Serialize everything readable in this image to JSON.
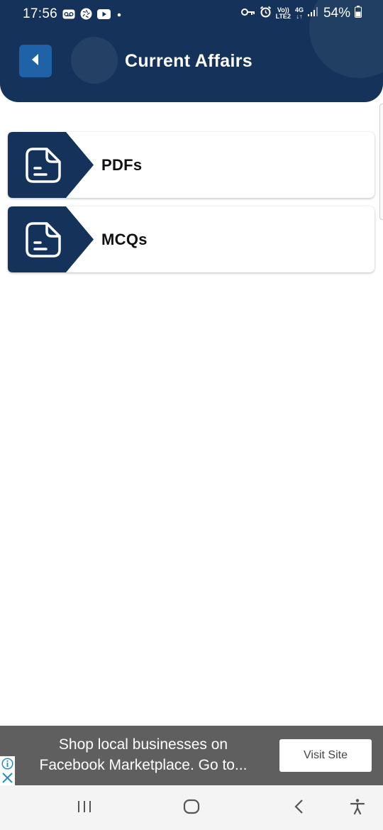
{
  "status_bar": {
    "time": "17:56",
    "network_lines": [
      "Vo))",
      "LTE2"
    ],
    "network_type": "4G",
    "battery": "54%",
    "left_icons": [
      "voicemail-icon",
      "aperture-icon",
      "youtube-icon",
      "dot-icon"
    ],
    "right_icons": [
      "key-icon",
      "alarm-icon",
      "signal-icon",
      "battery-icon"
    ]
  },
  "header": {
    "title": "Current Affairs",
    "back_icon": "chevron-left-icon"
  },
  "menu": [
    {
      "label": "PDFs",
      "icon": "document-icon"
    },
    {
      "label": "MCQs",
      "icon": "document-icon"
    }
  ],
  "ad": {
    "text_line1": "Shop local businesses on",
    "text_line2": "Facebook Marketplace. Go to...",
    "cta": "Visit Site",
    "icons": [
      "info-icon",
      "close-icon"
    ]
  },
  "nav_bar": {
    "icons": [
      "recent-apps-icon",
      "home-icon",
      "back-icon",
      "accessibility-icon"
    ]
  },
  "colors": {
    "header_bg": "#14325a",
    "back_button_bg": "#1f62a8",
    "badge_bg": "#14325a",
    "ad_bg": "#5f5f5f"
  }
}
